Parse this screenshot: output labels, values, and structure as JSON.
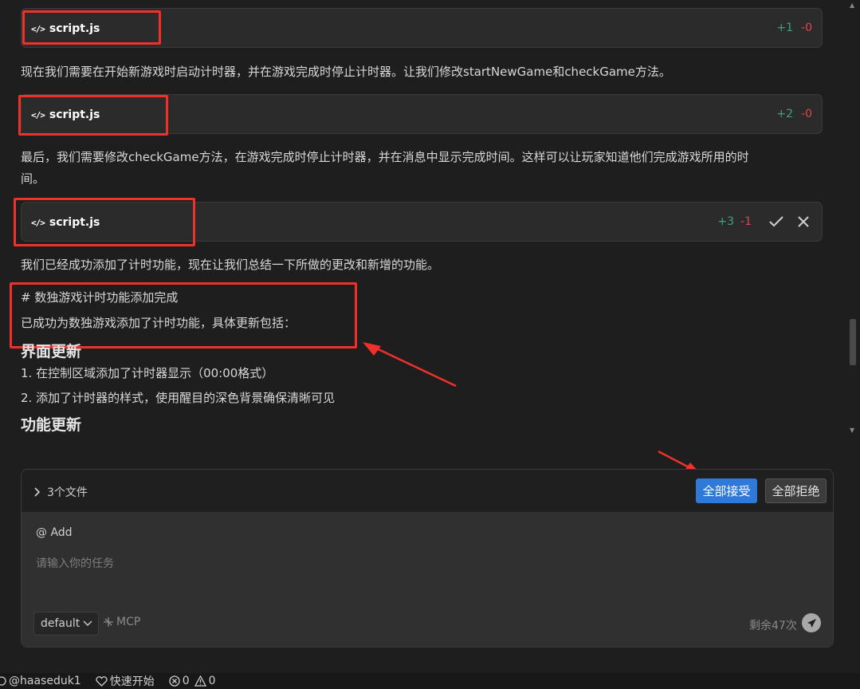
{
  "cards": [
    {
      "file": "script.js",
      "added": "+1",
      "removed": "-0"
    },
    {
      "file": "script.js",
      "added": "+2",
      "removed": "-0"
    },
    {
      "file": "script.js",
      "added": "+3",
      "removed": "-1"
    }
  ],
  "messages": {
    "p1": "现在我们需要在开始新游戏时启动计时器，并在游戏完成时停止计时器。让我们修改startNewGame和checkGame方法。",
    "p2_line1": "最后，我们需要修改checkGame方法，在游戏完成时停止计时器，并在消息中显示完成时间。这样可以让玩家知道他们完成游戏所用的时",
    "p2_line2": "间。",
    "p3": "我们已经成功添加了计时功能，现在让我们总结一下所做的更改和新增的功能。",
    "md_heading": "# 数独游戏计时功能添加完成",
    "summary": "已成功为数独游戏添加了计时功能，具体更新包括：",
    "section1": "界面更新",
    "item1": "1. 在控制区域添加了计时器显示（00:00格式）",
    "item2": "2. 添加了计时器的样式，使用醒目的深色背景确保清晰可见",
    "section2": "功能更新"
  },
  "panel": {
    "files_label": "3个文件",
    "accept_all": "全部接受",
    "reject_all": "全部拒绝",
    "add_label": "@ Add",
    "placeholder": "请输入你的任务",
    "model": "default",
    "mcp": "MCP",
    "remaining": "剩余47次"
  },
  "statusbar": {
    "user": "@haaseduk1",
    "quick_start": "快速开始",
    "errors": "0",
    "warnings": "0"
  },
  "colors": {
    "accent": "#2f7ad9",
    "added": "#3fa37a",
    "removed": "#e0474c",
    "annotation": "#f0302a"
  },
  "icons": [
    "code-icon",
    "check-icon",
    "close-icon",
    "chevron-right-icon",
    "chevron-down-icon",
    "mcp-icon",
    "send-icon",
    "account-icon",
    "heart-icon",
    "error-icon",
    "warning-icon"
  ]
}
